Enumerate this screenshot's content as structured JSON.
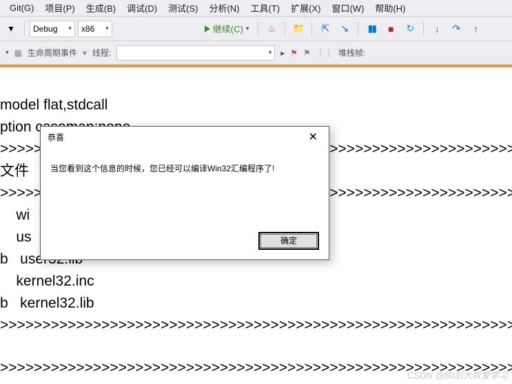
{
  "menu": {
    "git": "Git(G)",
    "project": "项目(P)",
    "build": "生成(B)",
    "debug": "调试(D)",
    "test": "测试(S)",
    "analyze": "分析(N)",
    "tools": "工具(T)",
    "extensions": "扩展(X)",
    "window": "窗口(W)",
    "help": "帮助(H)"
  },
  "toolbar": {
    "config": "Debug",
    "platform": "x86",
    "continue": "继续(C)"
  },
  "toolbar2": {
    "lifecycle": "生命周期事件",
    "thread": "线程:",
    "stackframe": "堆栈帧:"
  },
  "code": {
    "l1": "model flat,stdcall",
    "l2": "ption casemap:none",
    "l3": ">>>>>>>>>>>>>>>>>>>>>>>>>>>>>>>>>>>>>>>>>>>>>>>>>>>>>>>>>>>>>>",
    "l4": "文件",
    "l5": ">>>>>>>>>>>>>>>>>>>>>>>>>>>>>>>>>>>>>>>>>>>>>>>>>>>>>>>>>>>>>>",
    "l6": "    wi",
    "l7": "    us",
    "l8": "b   user32.lib",
    "l9": "    kernel32.inc",
    "l10": "b   kernel32.lib",
    "l11": ">>>>>>>>>>>>>>>>>>>>>>>>>>>>>>>>>>>>>>>>>>>>>>>>>>>>>>>>>>>>>>",
    "l12": ">>>>>>>>>>>>>>>>>>>>>>>>>>>>>>>>>>>>>>>>>>>>>>>>>>>>>>>>>>>>>>"
  },
  "dialog": {
    "title": "恭喜",
    "message": "当您看到这个信息的时候，您已经可以编译Win32汇编程序了!",
    "ok": "确定"
  },
  "watermark": "CSDN @80后大叔爱学习"
}
